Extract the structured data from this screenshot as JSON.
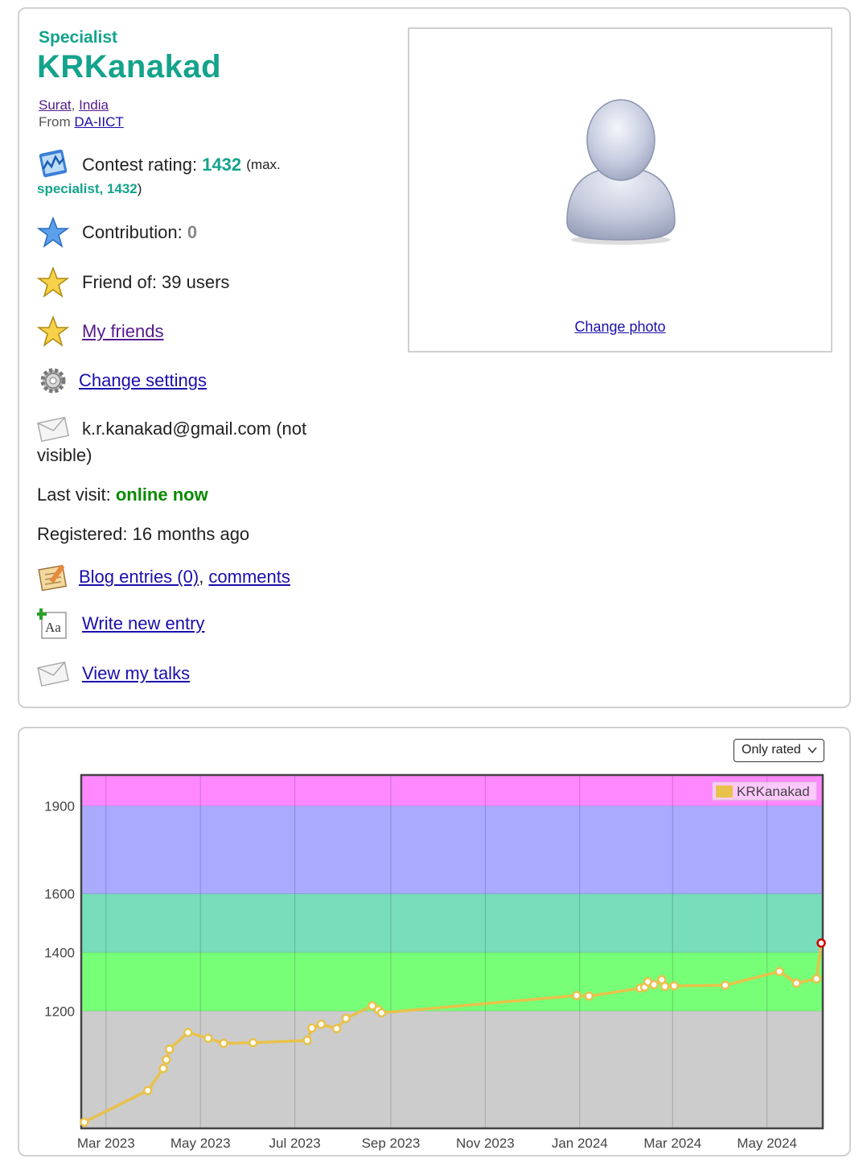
{
  "profile": {
    "rank": "Specialist",
    "handle": "KRKanakad",
    "city": "Surat",
    "country": "India",
    "from_label": "From",
    "organization": "DA-IICT",
    "contest_rating_label": "Contest rating:",
    "contest_rating": "1432",
    "max_prefix": "(max.",
    "max_rank_value": "specialist, 1432",
    "max_suffix": ")",
    "contribution_label": "Contribution:",
    "contribution": "0",
    "friend_of": "Friend of: 39 users",
    "my_friends": "My friends",
    "change_settings": "Change settings",
    "email": "k.r.kanakad@gmail.com (not",
    "email_cont": "visible)",
    "last_visit_label": "Last visit:",
    "last_visit": "online now",
    "registered": "Registered: 16 months ago",
    "blog_entries": "Blog entries (0)",
    "comments": "comments",
    "write_new_entry": "Write new entry",
    "view_talks": "View my talks",
    "change_photo": "Change photo"
  },
  "chart_controls": {
    "filter": "Only rated"
  },
  "colors": {
    "accent": "#14a38b",
    "line": "#e8c24a",
    "last_point": "#cc0000"
  },
  "chart_data": {
    "type": "line",
    "series": [
      {
        "name": "KRKanakad",
        "points": [
          [
            "2023-02-15",
            821
          ],
          [
            "2023-03-28",
            929
          ],
          [
            "2023-04-07",
            1004
          ],
          [
            "2023-04-09",
            1034
          ],
          [
            "2023-04-11",
            1070
          ],
          [
            "2023-04-23",
            1127
          ],
          [
            "2023-05-06",
            1107
          ],
          [
            "2023-05-16",
            1090
          ],
          [
            "2023-06-04",
            1092
          ],
          [
            "2023-07-09",
            1100
          ],
          [
            "2023-07-12",
            1142
          ],
          [
            "2023-07-18",
            1155
          ],
          [
            "2023-07-28",
            1140
          ],
          [
            "2023-08-03",
            1175
          ],
          [
            "2023-08-20",
            1218
          ],
          [
            "2023-08-24",
            1204
          ],
          [
            "2023-08-26",
            1194
          ],
          [
            "2023-12-30",
            1253
          ],
          [
            "2024-01-07",
            1251
          ],
          [
            "2024-02-09",
            1278
          ],
          [
            "2024-02-12",
            1282
          ],
          [
            "2024-02-14",
            1300
          ],
          [
            "2024-02-18",
            1290
          ],
          [
            "2024-02-23",
            1307
          ],
          [
            "2024-02-25",
            1284
          ],
          [
            "2024-03-02",
            1286
          ],
          [
            "2024-04-04",
            1288
          ],
          [
            "2024-05-09",
            1335
          ],
          [
            "2024-05-20",
            1295
          ],
          [
            "2024-06-02",
            1310
          ],
          [
            "2024-06-05",
            1432
          ]
        ]
      }
    ],
    "x_ticks": [
      "Mar 2023",
      "May 2023",
      "Jul 2023",
      "Sep 2023",
      "Nov 2023",
      "Jan 2024",
      "Mar 2024",
      "May 2024"
    ],
    "y_ticks": [
      1200,
      1400,
      1600,
      1900
    ],
    "xlim": [
      "2023-02-13",
      "2024-06-06"
    ],
    "ylim": [
      800,
      2005
    ],
    "bands": [
      {
        "from": 800,
        "to": 1200,
        "color": "#cccccc"
      },
      {
        "from": 1200,
        "to": 1400,
        "color": "#77ff77"
      },
      {
        "from": 1400,
        "to": 1600,
        "color": "#77ddbb"
      },
      {
        "from": 1600,
        "to": 1900,
        "color": "#aaaaff"
      },
      {
        "from": 1900,
        "to": 2005,
        "color": "#ff88ff"
      }
    ],
    "grid": true,
    "legend_position": "top-right"
  }
}
